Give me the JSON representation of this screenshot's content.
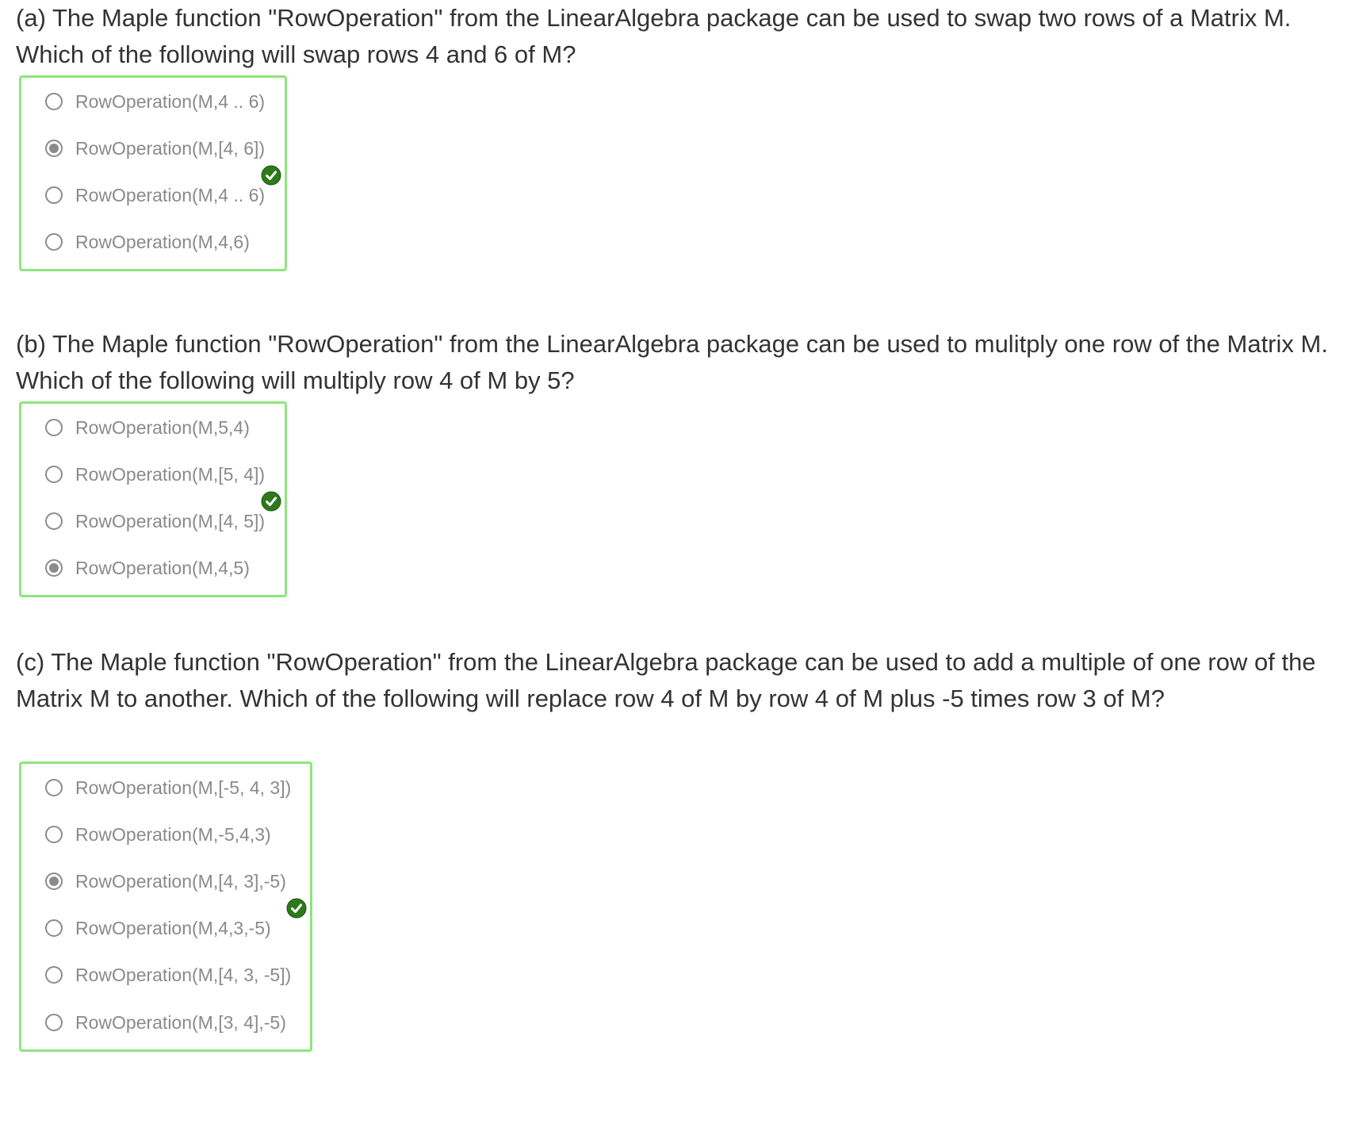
{
  "colors": {
    "box_border": "#8ee57e",
    "check_fill": "#2d7a1b",
    "option_text": "#8a8a8a",
    "question_text": "#333333"
  },
  "questions": [
    {
      "text": "(a) The Maple function \"RowOperation\" from the LinearAlgebra package can be used to swap two rows of a Matrix M. Which of the following will swap rows 4 and 6 of M?",
      "options": [
        {
          "label": "RowOperation(M,4 .. 6)",
          "selected": false
        },
        {
          "label": "RowOperation(M,[4, 6])",
          "selected": true
        },
        {
          "label": "RowOperation(M,4 .. 6)",
          "selected": false
        },
        {
          "label": "RowOperation(M,4,6)",
          "selected": false
        }
      ],
      "status_icon": "correct-check-icon"
    },
    {
      "text": "(b) The Maple function \"RowOperation\" from the LinearAlgebra package can be used to mulitply one row of the Matrix M.  Which of the following will multiply row 4 of M by 5?",
      "options": [
        {
          "label": "RowOperation(M,5,4)",
          "selected": false
        },
        {
          "label": "RowOperation(M,[5, 4])",
          "selected": false
        },
        {
          "label": "RowOperation(M,[4, 5])",
          "selected": false
        },
        {
          "label": "RowOperation(M,4,5)",
          "selected": true
        }
      ],
      "status_icon": "correct-check-icon"
    },
    {
      "text": "(c) The Maple function \"RowOperation\" from the LinearAlgebra package can be used to add a multiple of one row of the Matrix M to another.  Which of the following will replace row 4 of M by row 4 of M plus -5 times row 3 of M?",
      "options": [
        {
          "label": "RowOperation(M,[-5, 4, 3])",
          "selected": false
        },
        {
          "label": "RowOperation(M,-5,4,3)",
          "selected": false
        },
        {
          "label": "RowOperation(M,[4, 3],-5)",
          "selected": true
        },
        {
          "label": "RowOperation(M,4,3,-5)",
          "selected": false
        },
        {
          "label": "RowOperation(M,[4, 3, -5])",
          "selected": false
        },
        {
          "label": "RowOperation(M,[3, 4],-5)",
          "selected": false
        }
      ],
      "status_icon": "correct-check-icon"
    }
  ]
}
